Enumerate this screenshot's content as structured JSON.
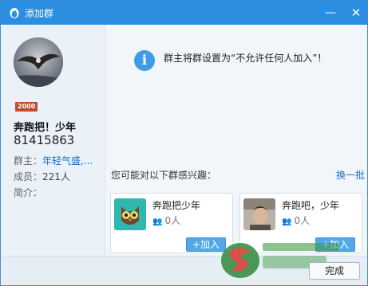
{
  "window": {
    "title": "添加群",
    "minimize_label": "—",
    "close_label": "✕"
  },
  "group": {
    "badge": "2000",
    "name": "奔跑把！少年",
    "id": "81415863",
    "owner_label": "群主：",
    "owner_value": "年轻气盛,...",
    "members_label": "成员：",
    "members_value": "221人",
    "intro_label": "简介："
  },
  "notice": {
    "icon": "info-icon",
    "text": "群主将群设置为“不允许任何人加入”！"
  },
  "suggestions": {
    "title": "您可能对以下群感兴趣：",
    "refresh_label": "换一批",
    "items": [
      {
        "name": "奔跑把少年",
        "count": "0人",
        "add_label": "+加入"
      },
      {
        "name": "奔跑吧，少年",
        "count": "0人",
        "add_label": "+加入"
      }
    ]
  },
  "footer": {
    "done_label": "完成"
  },
  "colors": {
    "titlebar": "#2b8ee0",
    "link": "#1f6dc7",
    "join_button": "#53a8e8",
    "info_icon": "#3f9be7"
  }
}
